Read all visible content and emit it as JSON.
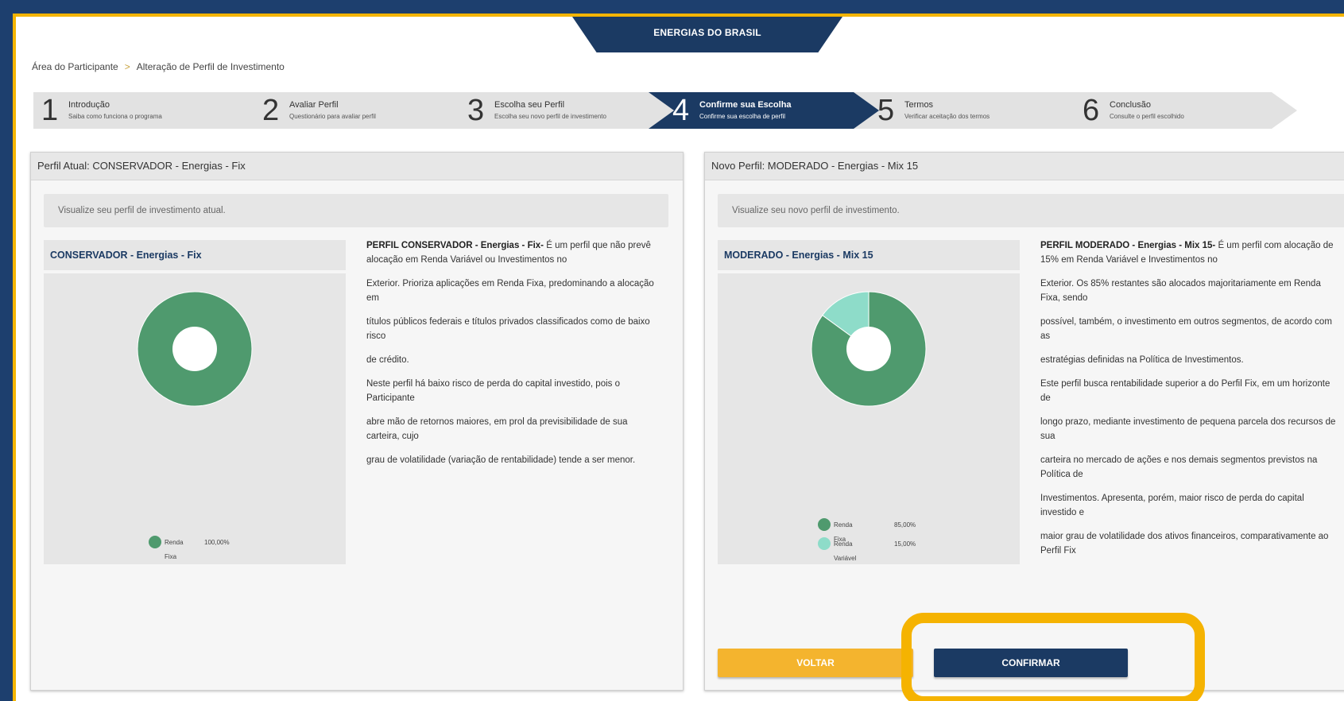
{
  "brand": {
    "name": "ENERGIAS DO BRASIL"
  },
  "breadcrumb": {
    "items": [
      "Área do Participante",
      "Alteração de Perfil de Investimento"
    ],
    "separator": ">"
  },
  "steps": [
    {
      "number": "1",
      "title": "Introdução",
      "subtitle": "Saiba como funciona o programa",
      "active": false
    },
    {
      "number": "2",
      "title": "Avaliar Perfil",
      "subtitle": "Questionário para avaliar perfil",
      "active": false
    },
    {
      "number": "3",
      "title": "Escolha seu Perfil",
      "subtitle": "Escolha seu novo perfil de investimento",
      "active": false
    },
    {
      "number": "4",
      "title": "Confirme sua Escolha",
      "subtitle": "Confirme sua escolha de perfil",
      "active": true
    },
    {
      "number": "5",
      "title": "Termos",
      "subtitle": "Verificar aceitação dos termos",
      "active": false
    },
    {
      "number": "6",
      "title": "Conclusão",
      "subtitle": "Consulte o perfil escolhido",
      "active": false
    }
  ],
  "current_profile": {
    "header": "Perfil Atual: CONSERVADOR - Energias - Fix",
    "info": "Visualize seu perfil de investimento atual.",
    "chart_title": "CONSERVADOR - Energias - Fix",
    "legend": [
      {
        "label": "Renda Fixa",
        "value": "100,00%",
        "color": "#4f9a6e"
      }
    ],
    "description_lead": "PERFIL CONSERVADOR - Energias - Fix-",
    "description": [
      " É um perfil que não prevê alocação em Renda Variável ou Investimentos no",
      "Exterior. Prioriza aplicações em Renda Fixa, predominando a alocação em",
      "títulos públicos federais e títulos privados classificados como de baixo risco",
      "de crédito.",
      "Neste perfil há baixo risco de perda do capital investido, pois o Participante",
      "abre mão de retornos maiores, em prol da previsibilidade de sua carteira, cujo",
      "grau de volatilidade (variação de rentabilidade) tende a ser menor."
    ]
  },
  "new_profile": {
    "header": "Novo Perfil: MODERADO - Energias - Mix 15",
    "info": "Visualize seu novo perfil de investimento.",
    "chart_title": "MODERADO - Energias - Mix 15",
    "legend": [
      {
        "label": "Renda Fixa",
        "value": "85,00%",
        "color": "#4f9a6e"
      },
      {
        "label": "Renda Variável",
        "value": "15,00%",
        "color": "#8edcc9"
      }
    ],
    "description_lead": "PERFIL MODERADO - Energias - Mix 15-",
    "description": [
      " É um perfil com alocação de 15% em Renda Variável e Investimentos no",
      "Exterior. Os 85% restantes são alocados majoritariamente em Renda Fixa, sendo",
      "possível, também, o investimento em outros segmentos, de acordo com as",
      "estratégias definidas na Política de Investimentos.",
      "Este perfil busca rentabilidade superior a do Perfil Fix, em um horizonte de",
      "longo prazo, mediante investimento de pequena parcela dos recursos de sua",
      "carteira no mercado de ações e nos demais segmentos previstos na Política de",
      "Investimentos. Apresenta, porém, maior risco de perda do capital investido e",
      "maior grau de volatilidade dos ativos financeiros, comparativamente ao Perfil Fix"
    ]
  },
  "buttons": {
    "back": "VOLTAR",
    "confirm": "CONFIRMAR"
  },
  "chart_data": [
    {
      "type": "pie",
      "title": "CONSERVADOR - Energias - Fix",
      "categories": [
        "Renda Fixa"
      ],
      "values": [
        100
      ],
      "colors": [
        "#4f9a6e"
      ],
      "legend": "bottom"
    },
    {
      "type": "pie",
      "title": "MODERADO - Energias - Mix 15",
      "categories": [
        "Renda Fixa",
        "Renda Variável"
      ],
      "values": [
        85,
        15
      ],
      "colors": [
        "#4f9a6e",
        "#8edcc9"
      ],
      "legend": "bottom"
    }
  ]
}
